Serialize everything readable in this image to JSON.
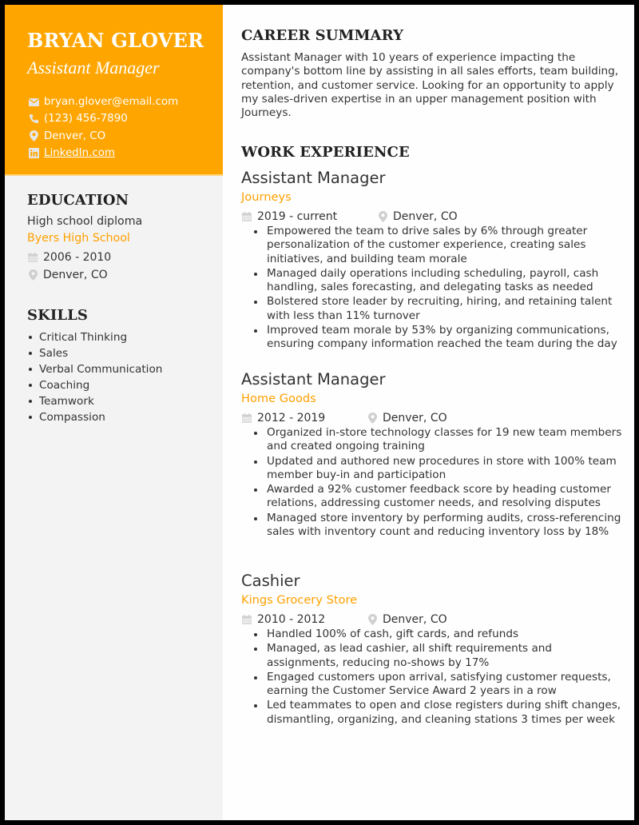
{
  "header": {
    "name": "BRYAN GLOVER",
    "title": "Assistant Manager",
    "contacts": [
      {
        "icon": "envelope-icon",
        "text": "bryan.glover@email.com"
      },
      {
        "icon": "phone-icon",
        "text": "(123) 456-7890"
      },
      {
        "icon": "map-pin-icon",
        "text": "Denver, CO"
      },
      {
        "icon": "linkedin-icon",
        "text": "LinkedIn.com"
      }
    ]
  },
  "education": {
    "heading": "EDUCATION",
    "degree": "High school diploma",
    "school": "Byers High School",
    "dates": "2006 - 2010",
    "location": "Denver, CO"
  },
  "skills": {
    "heading": "SKILLS",
    "items": [
      "Critical Thinking",
      "Sales",
      "Verbal Communication",
      "Coaching",
      "Teamwork",
      "Compassion"
    ]
  },
  "summary": {
    "heading": "CAREER SUMMARY",
    "text": "Assistant Manager with 10 years of experience impacting the company's bottom line by assisting in all sales efforts, team building, retention, and customer service. Looking for an opportunity to apply my sales-driven expertise in an upper management position with Journeys."
  },
  "work": {
    "heading": "WORK EXPERIENCE",
    "jobs": [
      {
        "role": "Assistant Manager",
        "company": "Journeys",
        "dates": "2019 - current",
        "location": "Denver, CO",
        "bullets": [
          "Empowered the team to drive sales by 6% through greater personalization of the customer experience, creating sales initiatives, and building team morale",
          "Managed daily operations including scheduling, payroll, cash handling, sales forecasting, and delegating tasks as needed",
          "Bolstered store leader by recruiting, hiring, and retaining talent with less than 11% turnover",
          "Improved team morale by 53% by organizing communications, ensuring company information reached the team during the day"
        ]
      },
      {
        "role": "Assistant Manager",
        "company": "Home Goods",
        "dates": "2012 - 2019",
        "location": "Denver, CO",
        "bullets": [
          "Organized in-store technology classes for 19 new team members and created ongoing training",
          "Updated and authored new procedures in store with 100% team member buy-in and participation",
          "Awarded a 92% customer feedback score by heading customer relations, addressing customer needs, and resolving disputes",
          "Managed store inventory by performing audits, cross-referencing sales with inventory count and reducing inventory loss by 18%"
        ]
      },
      {
        "role": "Cashier",
        "company": "Kings Grocery Store",
        "dates": "2010 - 2012",
        "location": "Denver, CO",
        "bullets": [
          "Handled 100% of cash, gift cards, and refunds",
          "Managed, as lead cashier, all shift requirements and assignments, reducing no-shows by 17%",
          "Engaged customers upon arrival, satisfying customer requests, earning the Customer Service Award 2 years in a row",
          "Led teammates to open and close registers during shift changes, dismantling, organizing, and cleaning stations 3 times per week"
        ]
      }
    ]
  },
  "colors": {
    "accent": "#ffa500",
    "accent_text": "#ffa000",
    "sidebar_bg": "#f3f3f3",
    "icon_gray": "#cfcfcf",
    "text": "#333333"
  }
}
